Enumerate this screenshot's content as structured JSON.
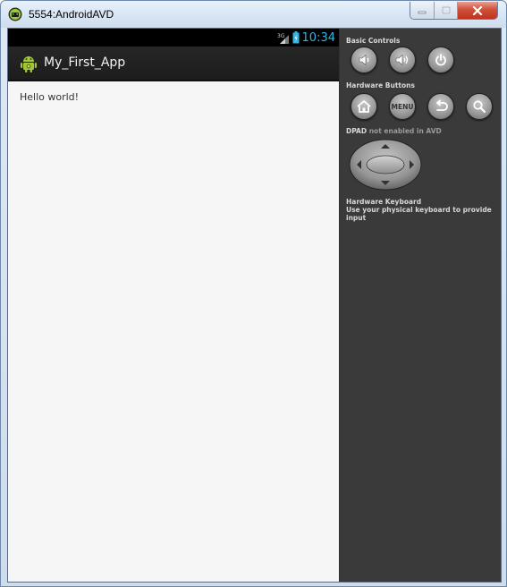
{
  "window": {
    "title": "5554:AndroidAVD",
    "icons": {
      "app": "avd-icon",
      "minimize": "minimize-icon",
      "maximize": "maximize-icon",
      "close": "close-icon"
    }
  },
  "device": {
    "status": {
      "network": "3G",
      "clock": "10:34",
      "icons": [
        "signal-icon",
        "battery-icon"
      ]
    },
    "app_bar": {
      "title": "My_First_App",
      "icon": "android-icon"
    },
    "content": {
      "text": "Hello world!"
    }
  },
  "controls": {
    "basic": {
      "label": "Basic Controls",
      "buttons": [
        "volume-down-icon",
        "volume-up-icon",
        "power-icon"
      ]
    },
    "hardware": {
      "label": "Hardware Buttons",
      "menu_label": "MENU",
      "buttons": [
        "home-icon",
        "menu-button",
        "back-icon",
        "search-icon"
      ]
    },
    "dpad": {
      "label": "DPAD",
      "note": "not enabled in AVD"
    },
    "keyboard": {
      "label": "Hardware Keyboard",
      "note": "Use your physical keyboard to provide input"
    }
  },
  "colors": {
    "clock": "#33b5e5",
    "panel": "#3a3a3a",
    "screen": "#f6f6f6",
    "action_bar": "#222222"
  }
}
